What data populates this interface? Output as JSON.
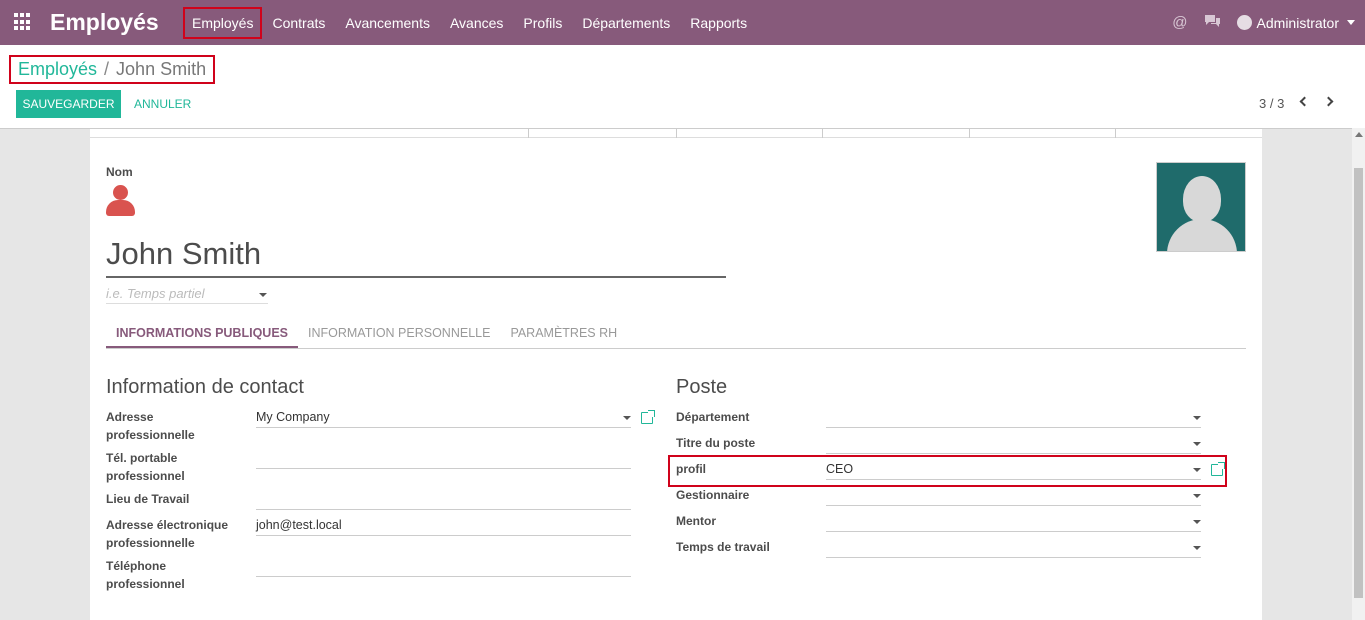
{
  "navbar": {
    "app_title": "Employés",
    "menu": [
      "Employés",
      "Contrats",
      "Avancements",
      "Avances",
      "Profils",
      "Départements",
      "Rapports"
    ],
    "at_icon": "@",
    "user": "Administrator"
  },
  "breadcrumb": {
    "parent": "Employés",
    "separator": "/",
    "current": "John Smith"
  },
  "actions": {
    "save": "SAUVEGARDER",
    "discard": "ANNULER"
  },
  "pager": {
    "value": "3 / 3"
  },
  "form": {
    "name_label": "Nom",
    "employee_name": "John Smith",
    "job_placeholder": "i.e. Temps partiel",
    "tabs": [
      "INFORMATIONS PUBLIQUES",
      "INFORMATION PERSONNELLE",
      "PARAMÈTRES RH"
    ],
    "contact": {
      "title": "Information de contact",
      "fields": [
        {
          "label": "Adresse professionnelle",
          "value": "My Company"
        },
        {
          "label": "Tél. portable professionnel",
          "value": ""
        },
        {
          "label": "Lieu de Travail",
          "value": ""
        },
        {
          "label": "Adresse électronique professionnelle",
          "value": "john@test.local"
        },
        {
          "label": "Téléphone professionnel",
          "value": ""
        }
      ]
    },
    "position": {
      "title": "Poste",
      "fields": [
        {
          "label": "Département",
          "value": ""
        },
        {
          "label": "Titre du poste",
          "value": ""
        },
        {
          "label": "profil",
          "value": "CEO"
        },
        {
          "label": "Gestionnaire",
          "value": ""
        },
        {
          "label": "Mentor",
          "value": ""
        },
        {
          "label": "Temps de travail",
          "value": ""
        }
      ]
    }
  },
  "colors": {
    "navbar": "#875a7b",
    "accent": "#21b799",
    "highlight": "#d0021b",
    "avatar": "#d9534f"
  }
}
